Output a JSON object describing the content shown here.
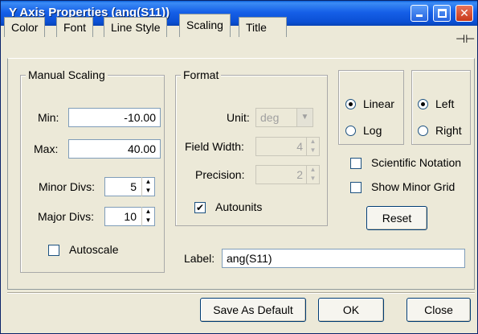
{
  "window": {
    "title": "Y Axis Properties (ang(S11))"
  },
  "tabs": [
    {
      "label": "Color",
      "active": false
    },
    {
      "label": "Font",
      "active": false
    },
    {
      "label": "Line Style",
      "active": false
    },
    {
      "label": "Scaling",
      "active": true
    },
    {
      "label": "Title",
      "active": false
    }
  ],
  "manual_scaling": {
    "title": "Manual Scaling",
    "min_label": "Min:",
    "min_value": "-10.00",
    "max_label": "Max:",
    "max_value": "40.00",
    "minor_divs_label": "Minor Divs:",
    "minor_divs_value": "5",
    "major_divs_label": "Major Divs:",
    "major_divs_value": "10",
    "autoscale_label": "Autoscale",
    "autoscale_checked": false
  },
  "format": {
    "title": "Format",
    "unit_label": "Unit:",
    "unit_value": "deg",
    "field_width_label": "Field Width:",
    "field_width_value": "4",
    "precision_label": "Precision:",
    "precision_value": "2",
    "autounits_label": "Autounits",
    "autounits_checked": true
  },
  "scale_type": {
    "linear_label": "Linear",
    "log_label": "Log",
    "selected": "Linear"
  },
  "side": {
    "left_label": "Left",
    "right_label": "Right",
    "selected": "Left"
  },
  "options": {
    "scientific_label": "Scientific Notation",
    "scientific_checked": false,
    "minor_grid_label": "Show Minor Grid",
    "minor_grid_checked": false,
    "reset_label": "Reset"
  },
  "label_field": {
    "label": "Label:",
    "value": "ang(S11)"
  },
  "footer": {
    "save_default_label": "Save As Default",
    "ok_label": "OK",
    "close_label": "Close"
  }
}
